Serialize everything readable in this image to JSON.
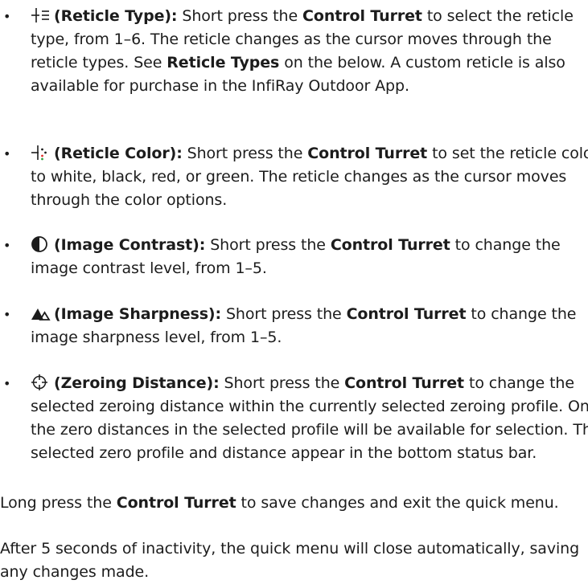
{
  "items": [
    {
      "icon": "reticle-type-icon",
      "label": "(Reticle Type):",
      "t1": " Short press the ",
      "b1": "Control Turret",
      "t2": " to select the reticle type, from 1–6. The reticle changes as the cursor moves through the reticle types. See ",
      "b2": "Reticle Types",
      "t3": " on the below. A custom reticle is also available for purchase in the InfiRay Outdoor App."
    },
    {
      "icon": "reticle-color-icon",
      "label": "(Reticle Color):",
      "t1": " Short press the ",
      "b1": "Control Turret",
      "t2": " to set the reticle color to white, black, red, or green. The reticle changes as the cursor moves through the color options."
    },
    {
      "icon": "image-contrast-icon",
      "label": "(Image Contrast):",
      "t1": " Short press the ",
      "b1": "Control Turret",
      "t2": " to change the image contrast level, from 1–5."
    },
    {
      "icon": "image-sharpness-icon",
      "label": "(Image Sharpness):",
      "t1": " Short press the ",
      "b1": "Control Turret",
      "t2": " to change the image sharpness level, from 1–5."
    },
    {
      "icon": "zeroing-distance-icon",
      "label": "(Zeroing Distance):",
      "t1": " Short press the ",
      "b1": "Control Turret",
      "t2": " to change the selected zeroing distance within the currently selected zeroing profile. Only the zero distances in the selected profile will be available for selection. The selected zero profile and distance appear in the bottom status bar."
    }
  ],
  "para1": {
    "t1": "Long press the ",
    "b1": "Control Turret",
    "t2": " to save changes and exit the quick menu."
  },
  "para2": {
    "t1": "After 5 seconds of inactivity, the quick menu will close automatically, saving any changes made."
  },
  "colors": {
    "text": "#1c1c1c",
    "reticle_red": "#e0302a",
    "reticle_green": "#2e9e3e"
  }
}
